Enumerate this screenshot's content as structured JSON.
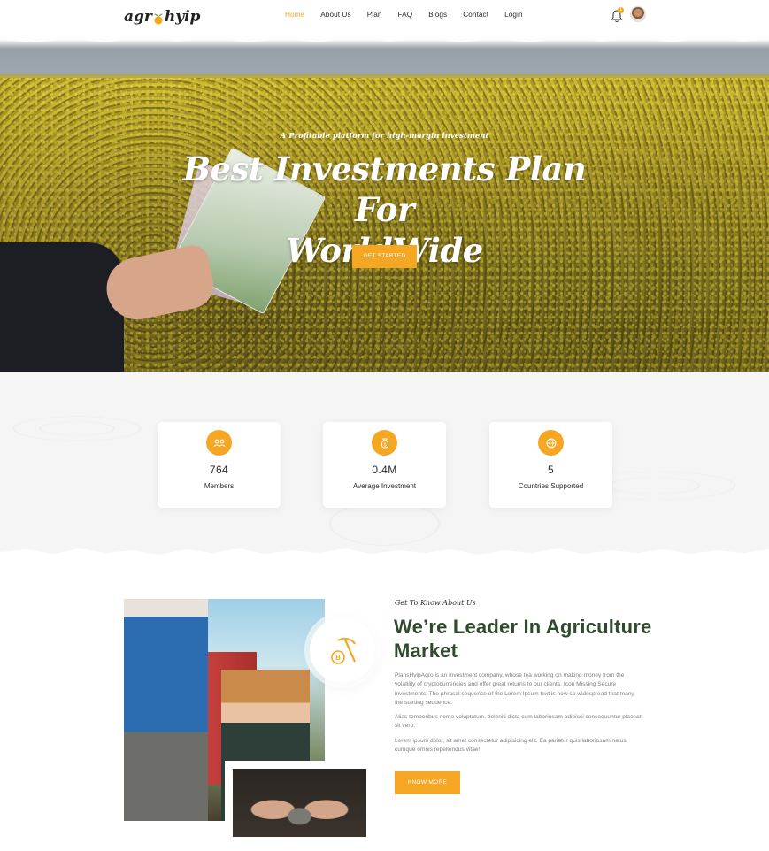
{
  "header": {
    "logo_text_left": "agr",
    "logo_text_right": "hyip",
    "nav": [
      {
        "label": "Home",
        "active": true
      },
      {
        "label": "About Us"
      },
      {
        "label": "Plan"
      },
      {
        "label": "FAQ"
      },
      {
        "label": "Blogs"
      },
      {
        "label": "Contact"
      },
      {
        "label": "Login"
      }
    ],
    "notification_count": "1"
  },
  "hero": {
    "subtitle": "A Profitable platform for high-margin investment",
    "title_line1": "Best Investments Plan For",
    "title_line2": "WorldWide",
    "cta": "GET STARTED"
  },
  "stats": [
    {
      "icon": "members-icon",
      "value": "764",
      "label": "Members"
    },
    {
      "icon": "money-bag-icon",
      "value": "0.4M",
      "label": "Average Investment"
    },
    {
      "icon": "globe-icon",
      "value": "5",
      "label": "Countries Supported"
    }
  ],
  "about": {
    "tag": "Get To Know About Us",
    "title": "We’re Leader In Agriculture Market",
    "p1": "PlansHyipAgro is an investment company, whose tea working on making money from the volatility of cryptocurrencies and offer great returns to our clients. Icon Missing Secure investments. The phrasal sequence of the Lorem Ipsum text is now so widespread that many the starting sequence.",
    "p2": "Alias temporibus nemo voluptatum, deleniti dicta cum laboriosam adipisci consequuntur placeat sit vero.",
    "p3": "Lorem ipsum dolor, sit amet consectetur adipisicing elit. Ea pariatur quis laboriosam natus cumque omnis repellendus vitae!",
    "cta": "KNOW MORE"
  },
  "colors": {
    "accent": "#f5a623",
    "heading": "#2f4a2c",
    "text_muted": "#7b7f88"
  }
}
